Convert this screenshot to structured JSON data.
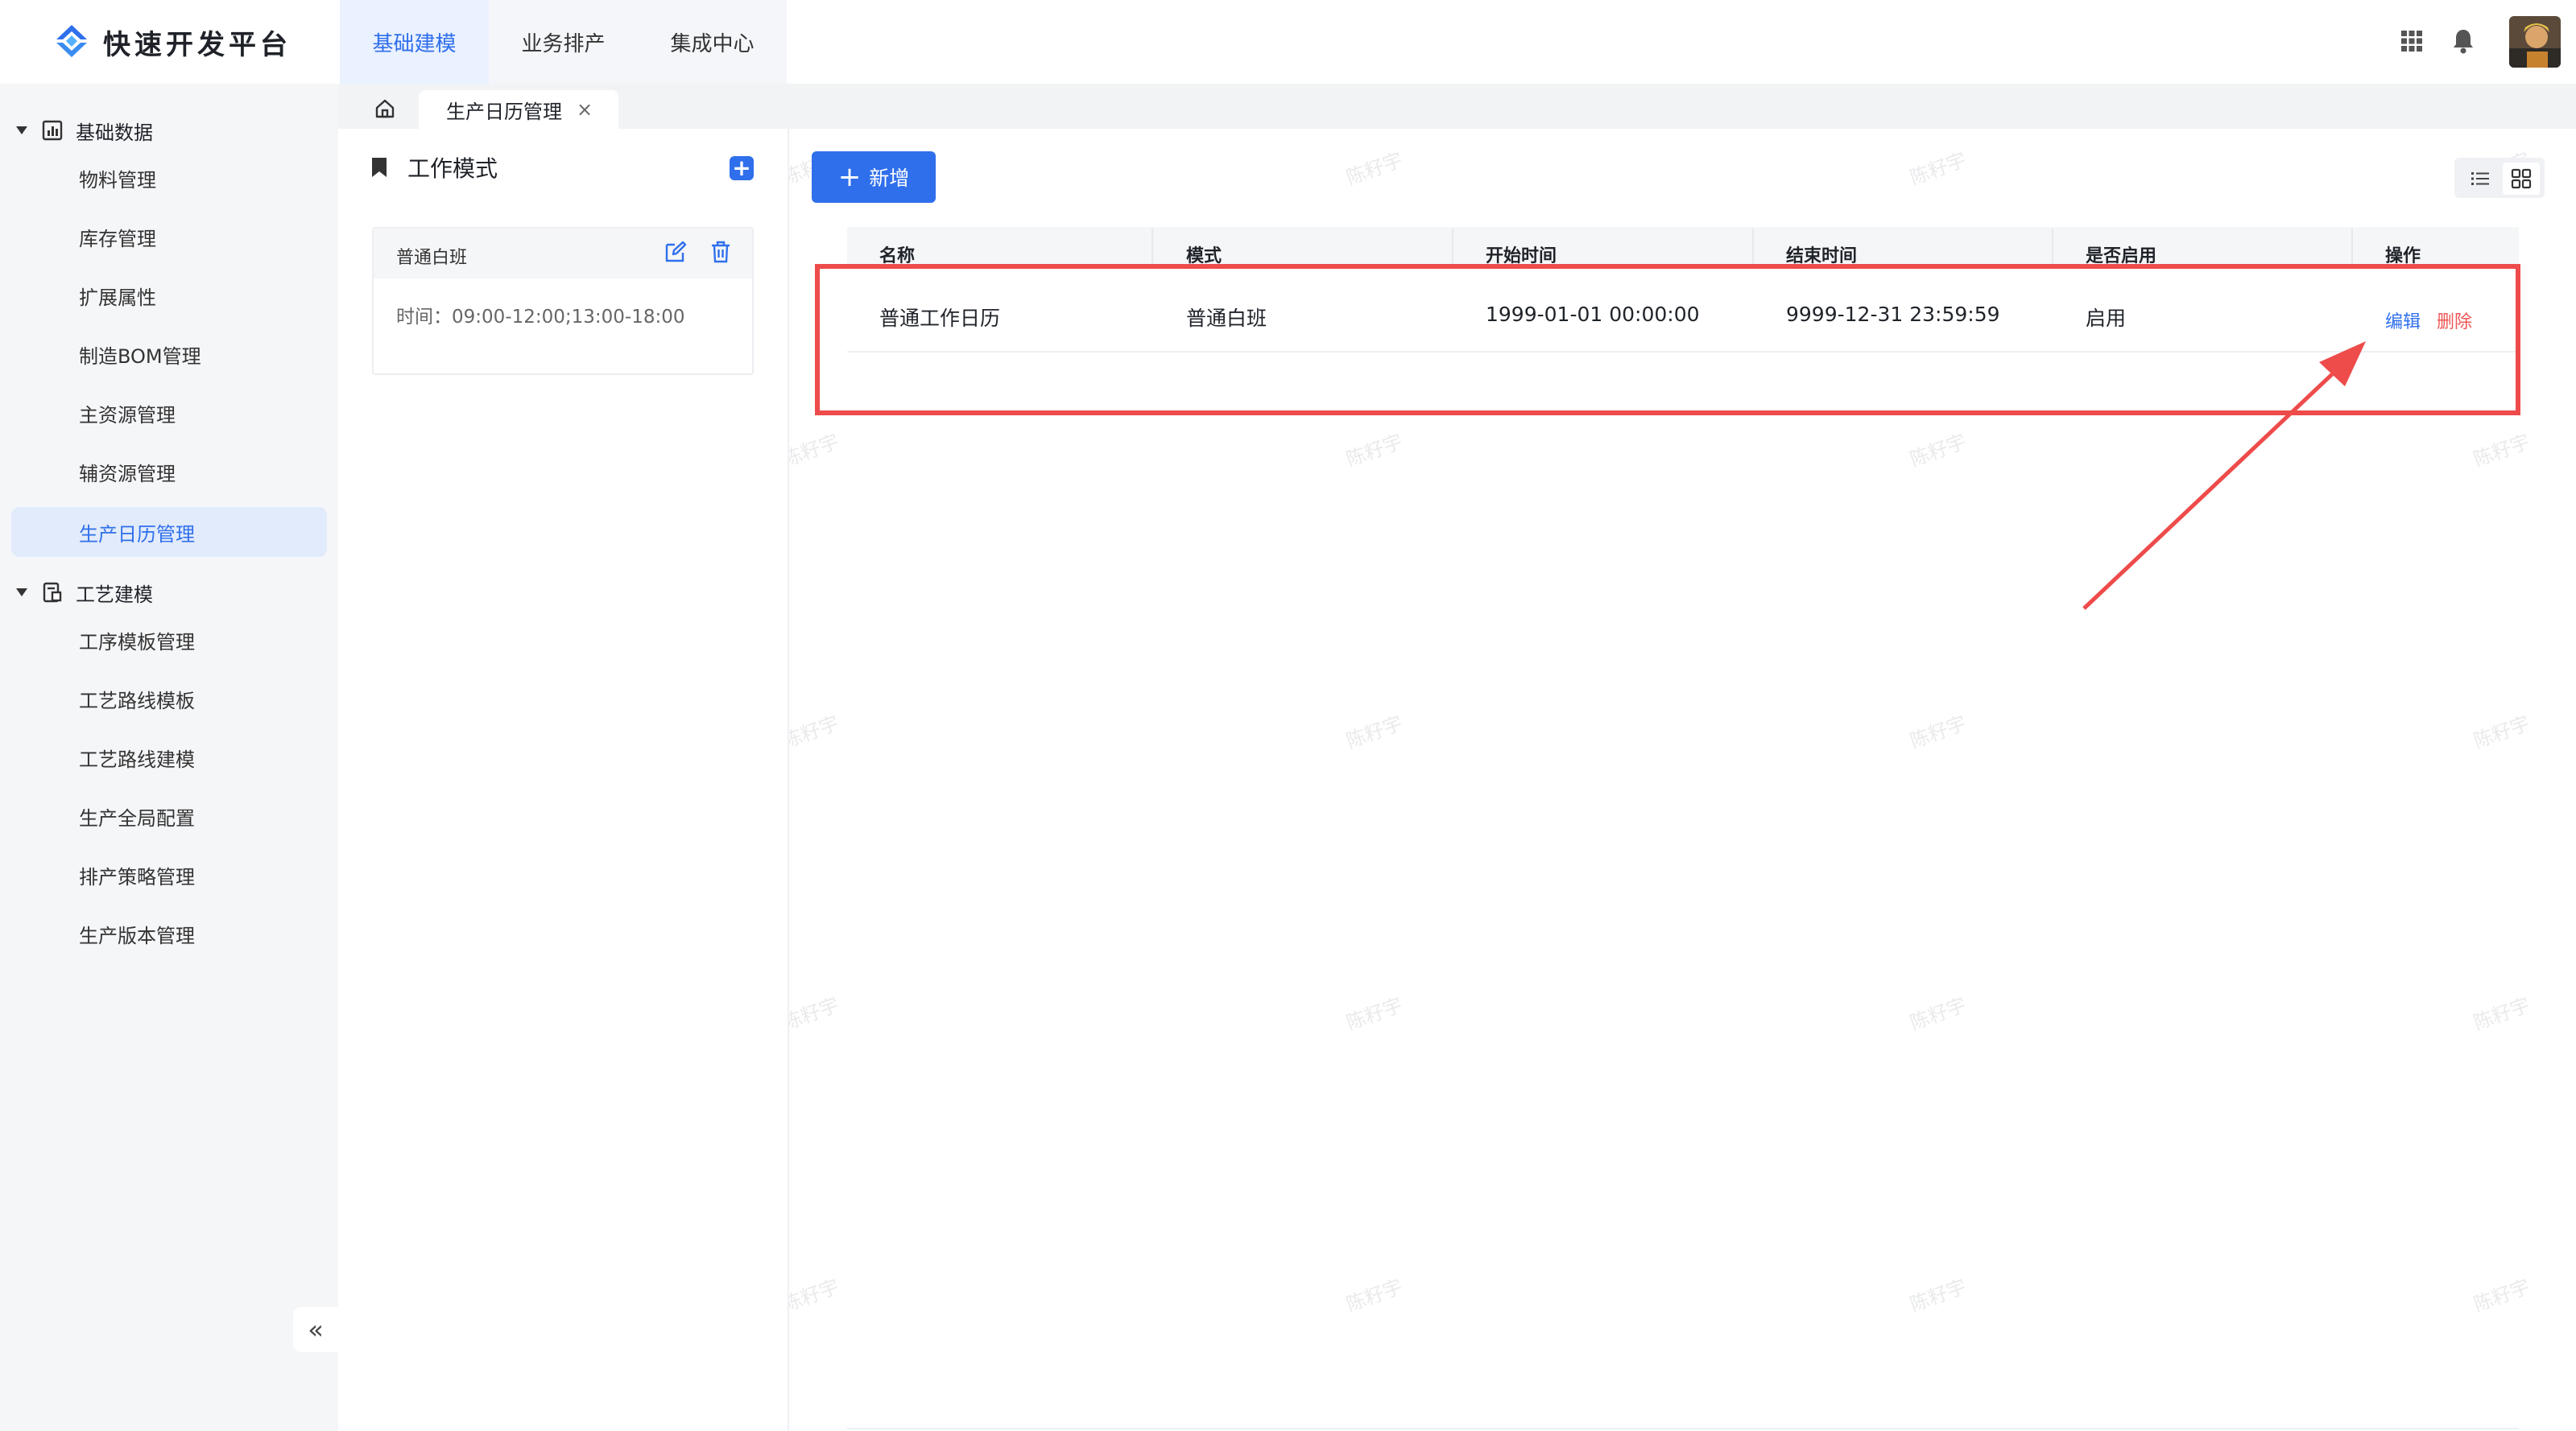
{
  "app": {
    "title": "快速开发平台"
  },
  "topnav": {
    "items": [
      "基础建模",
      "业务排产",
      "集成中心"
    ],
    "active_index": 0
  },
  "sidebar": {
    "groups": [
      {
        "label": "基础数据",
        "icon": "bar-chart-icon",
        "items": [
          "物料管理",
          "库存管理",
          "扩展属性",
          "制造BOM管理",
          "主资源管理",
          "辅资源管理",
          "生产日历管理"
        ]
      },
      {
        "label": "工艺建模",
        "icon": "process-icon",
        "items": [
          "工序模板管理",
          "工艺路线模板",
          "工艺路线建模",
          "生产全局配置",
          "排产策略管理",
          "生产版本管理"
        ]
      }
    ],
    "active_item": "生产日历管理",
    "collapse_label": "«"
  },
  "tabs": {
    "active_label": "生产日历管理",
    "close_glyph": "×"
  },
  "mode_panel": {
    "title": "工作模式",
    "card": {
      "name": "普通白班",
      "time": "时间：09:00-12:00;13:00-18:00"
    }
  },
  "toolbar": {
    "add_label": "新增",
    "add_glyph": "+"
  },
  "table": {
    "columns": [
      "名称",
      "模式",
      "开始时间",
      "结束时间",
      "是否启用",
      "操作"
    ],
    "rows": [
      {
        "name": "普通工作日历",
        "mode": "普通白班",
        "start": "1999-01-01 00:00:00",
        "end": "9999-12-31 23:59:59",
        "enabled": "启用",
        "edit": "编辑",
        "delete": "删除"
      }
    ]
  },
  "watermark": "陈籽宇",
  "colors": {
    "primary": "#2f6fec",
    "danger": "#f05555",
    "annotation": "#ee4b4b",
    "sidebar_bg": "#f5f6f8",
    "active_bg": "#e2ebfb"
  }
}
